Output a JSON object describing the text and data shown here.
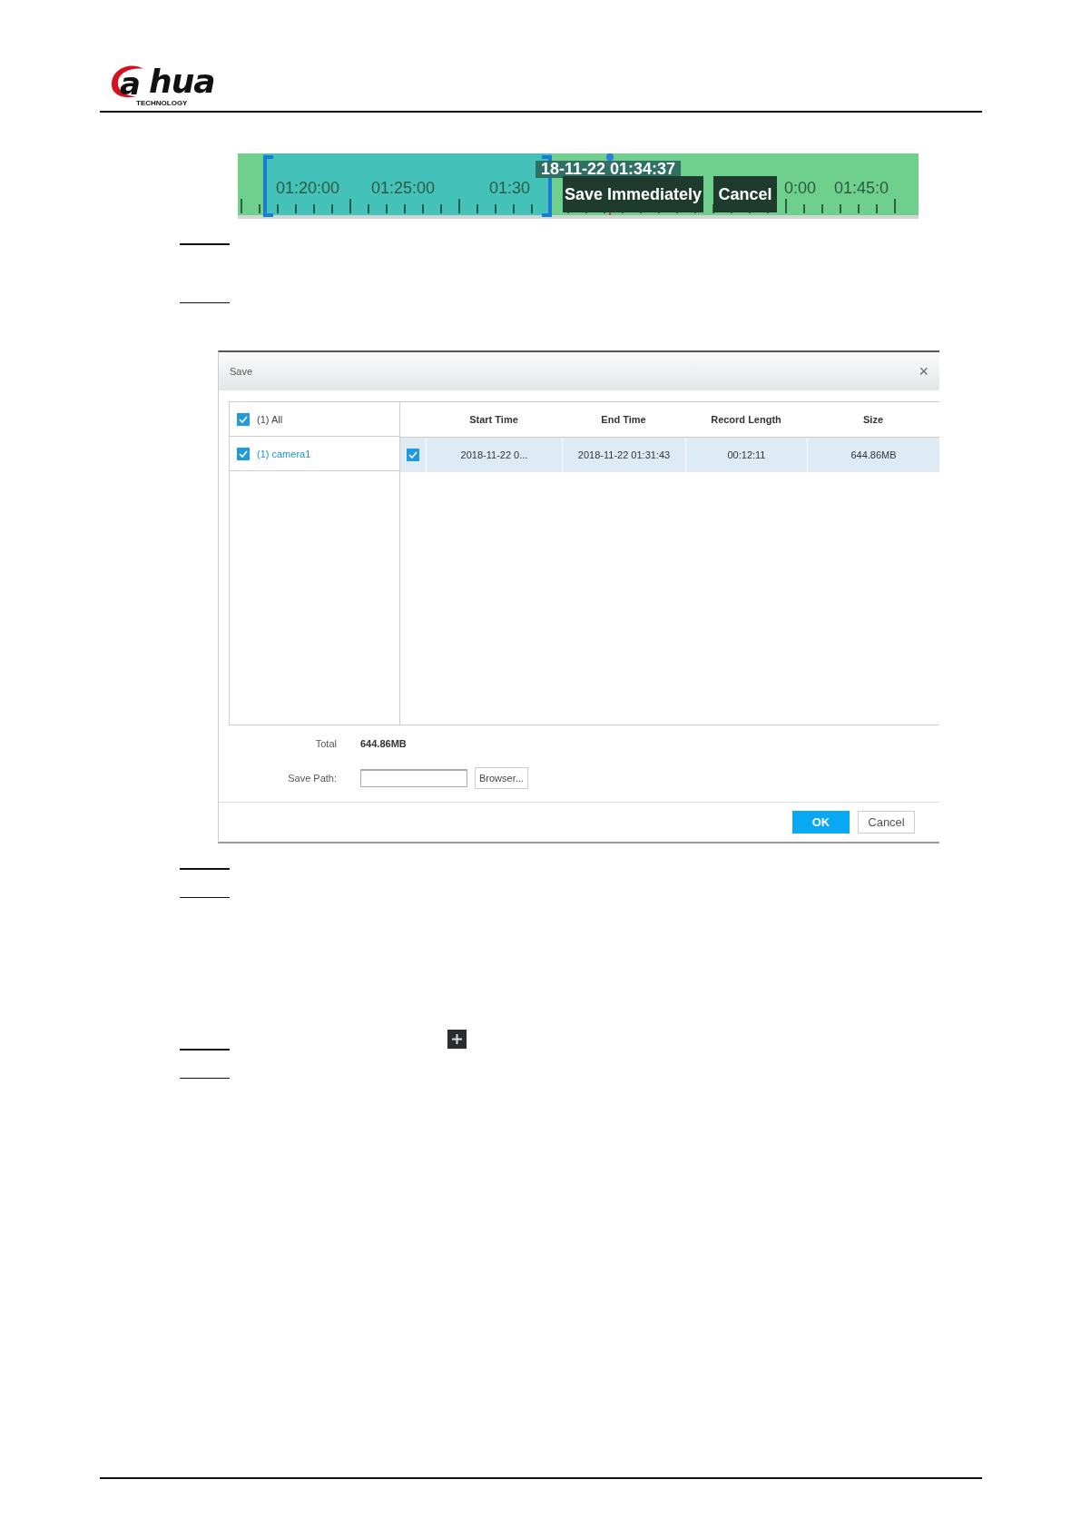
{
  "header": {
    "logo": {
      "mark": "a",
      "name": "hua",
      "tagline": "TECHNOLOGY"
    }
  },
  "timeline": {
    "ticks": [
      "01:20:00",
      "01:25:00",
      "01:30",
      "0:00",
      "01:45:0"
    ],
    "tooltip": "18-11-22 01:34:37",
    "buttons": [
      "Save Immediately",
      "Cancel"
    ]
  },
  "dialog": {
    "title": "Save",
    "close": "×",
    "tree": [
      {
        "label": "(1) All",
        "checked": true,
        "selected": false
      },
      {
        "label": "(1) camera1",
        "checked": true,
        "selected": true
      }
    ],
    "columns": [
      "Start Time",
      "End Time",
      "Record Length",
      "Size"
    ],
    "rows": [
      {
        "checked": true,
        "selected": true,
        "cells": [
          "2018-11-22 0...",
          "2018-11-22 01:31:43",
          "00:12:11",
          "644.86MB"
        ]
      }
    ],
    "total_label": "Total",
    "total": "644.86MB",
    "save_path": {
      "label": "Save Path:"
    },
    "browse_button": "Browser...",
    "buttons": [
      {
        "label": "OK",
        "kind": "primary"
      },
      {
        "label": "Cancel",
        "kind": "secondary"
      }
    ]
  }
}
